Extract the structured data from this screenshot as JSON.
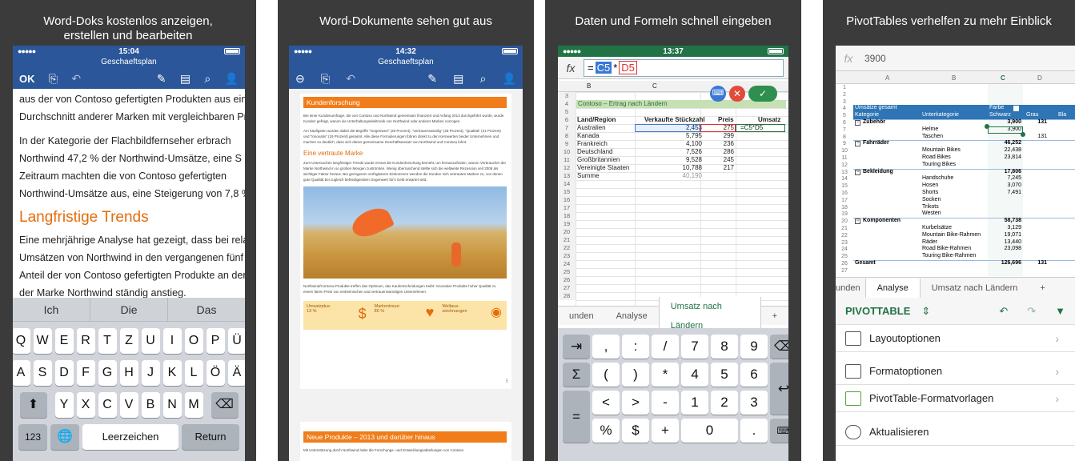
{
  "panels": [
    {
      "caption": "Word-Doks kostenlos anzeigen,\nerstellen und bearbeiten"
    },
    {
      "caption": "Word-Dokumente sehen gut aus"
    },
    {
      "caption": "Daten und Formeln schnell eingeben"
    },
    {
      "caption": "PivotTables verhelfen zu mehr Einblick"
    }
  ],
  "word1": {
    "time": "15:04",
    "title": "Geschaeftsplan",
    "ok": "OK",
    "lines_a": [
      "aus der von Contoso gefertigten Produkten aus einer Ge",
      "Durchschnitt anderer Marken mit vergleichbaren Pr"
    ],
    "lines_b": [
      "In der Kategorie der Flachbildfernseher erbrach",
      "Northwind 47,2 % der Northwind-Umsätze, eine S",
      "Zeitraum machten die von Contoso gefertigten",
      "Northwind-Umsätze aus, eine Steigerung von 7,8 %"
    ],
    "heading": "Langfristige Trends",
    "lines_c": [
      "Eine mehrjährige Analyse hat gezeigt, dass bei rela",
      "Umsätzen von Northwind in den vergangenen fünf",
      "Anteil der von Contoso gefertigten Produkte an der",
      "der Marke Northwind ständig anstieg."
    ],
    "suggestions": [
      "Ich",
      "Die",
      "Das"
    ],
    "row1": [
      "Q",
      "W",
      "E",
      "R",
      "T",
      "Z",
      "U",
      "I",
      "O",
      "P",
      "Ü"
    ],
    "row2": [
      "A",
      "S",
      "D",
      "F",
      "G",
      "H",
      "J",
      "K",
      "L",
      "Ö",
      "Ä"
    ],
    "row3": [
      "Y",
      "X",
      "C",
      "V",
      "B",
      "N",
      "M"
    ],
    "k123": "123",
    "space": "Leerzeichen",
    "ret": "Return"
  },
  "word2": {
    "time": "14:32",
    "title": "Geschaeftsplan",
    "h1": "Kundenforschung",
    "p1": "Bei einer Kundenumfrage, die von Contoso und Northwind gemeinsam finanziert und Anfang 2013 durchgeführt wurde, wurde Kunden gefragt, warum sie Unterhaltungselektronik von Northwind oder anderer Marken vorzogen.",
    "p2": "Am häufigsten wurden dabei die Begriffe \"Gegenwert\" (26 Prozent), \"vertrauenswürdig\" (29 Prozent), \"Qualität\" (21 Prozent) und \"innovativ\" (19 Prozent) genannt. Alle diese Formulierungen führen direkt zu den Kernwerten beider Unternehmen und machen so deutlich, dass sich dieser gemeinsame Geschäftsansatz von Northwind und Contoso lohnt.",
    "h2": "Eine vertraute Marke",
    "p3": "Zum Untersuchen langfristiger Trends wurde erneut die Kundenforschung bemüht, um herauszufinden, warum Verbraucher der Marke Northwind in so großen Mengen zuströmten. Wenig überraschend stellte sich die weltweite Rezession seit 2008 als wichtiger Faktor heraus. Bei geringerem verfügbarem Einkommen wenden die Kunden sich vertrauten Marken zu, von denen gute Qualität bei zugleich befriedigendem Gegenwert für's Geld erwartet wird.",
    "p4": "Northwind/Contoso-Produkte treffen das Optimum, das Kaufentscheidungen treibt: innovative Produkte hoher Qualität zu einem fairen Preis von einheimischen und vertrauenswürdigen Unternehmen.",
    "info": [
      {
        "label": "Umsatzplus:",
        "value": "13 %"
      },
      {
        "label": "Markentreue:",
        "value": "80 %"
      },
      {
        "label": "Weltaus-\nzeichnungen",
        "value": ""
      }
    ],
    "page_no": "5",
    "h3": "Neue Produkte – 2013 und darüber hinaus",
    "p5": "Mit Unterstützung durch Northwind habe die Forschungs- und Entwicklungsabteilungen von Contoso"
  },
  "excel": {
    "time": "13:37",
    "fx": "fx",
    "formula_a": "C5",
    "formula_op": "*",
    "formula_b": "D5",
    "cols": [
      "B",
      "C"
    ],
    "title": "Contoso – Ertrag nach Ländern",
    "headers": [
      "Land/Region",
      "Verkaufte Stückzahl",
      "Preis",
      "Umsatz"
    ],
    "rows": [
      [
        "Australien",
        "2,453",
        "275",
        "=C5*D5"
      ],
      [
        "Kanada",
        "5,795",
        "299",
        ""
      ],
      [
        "Frankreich",
        "4,100",
        "236",
        ""
      ],
      [
        "Deutschland",
        "7,526",
        "286",
        ""
      ],
      [
        "Großbritannien",
        "9,528",
        "245",
        ""
      ],
      [
        "Vereinigte Staaten",
        "10,788",
        "217",
        ""
      ],
      [
        "Summe",
        "40,190",
        "",
        ""
      ]
    ],
    "tabs": [
      "unden",
      "Analyse",
      "Umsatz nach Ländern",
      "+"
    ],
    "keys": {
      "r1": [
        "⇥",
        ",",
        ":",
        "/",
        "7",
        "8",
        "9",
        "⌫"
      ],
      "r2": [
        "Σ",
        "(",
        ")",
        "*",
        "4",
        "5",
        "6"
      ],
      "r3": [
        "=",
        "<",
        ">",
        "-",
        "1",
        "2",
        "3"
      ],
      "r4": [
        "%",
        "$",
        "+",
        "0",
        "."
      ],
      "ret": "↩",
      "kbd": "⌨"
    }
  },
  "pivot": {
    "fx": "fx",
    "value": "3900",
    "cols": [
      "A",
      "B",
      "C",
      "D"
    ],
    "rownums": [
      "1",
      "2",
      "3",
      "4",
      "5",
      "6",
      "7",
      "8",
      "9",
      "10",
      "11",
      "12",
      "13",
      "14",
      "15",
      "16",
      "17",
      "18",
      "19",
      "20",
      "21",
      "22",
      "23",
      "24",
      "25",
      "26",
      "27"
    ],
    "hdr": {
      "a": "Umsätze gesamt",
      "b": "Farbe",
      "c": "Kategorie",
      "d": "Unterkategorie",
      "e": "Schwarz",
      "f": "Grau",
      "g": "Bla"
    },
    "rows": [
      {
        "cat": "Zubehör",
        "sub": "",
        "v": "3,900",
        "g": "131"
      },
      {
        "cat": "",
        "sub": "Helme",
        "v": "3,900",
        "g": ""
      },
      {
        "cat": "",
        "sub": "Taschen",
        "v": "",
        "g": "131"
      },
      {
        "cat": "Fahrräder",
        "sub": "",
        "v": "46,252",
        "g": ""
      },
      {
        "cat": "",
        "sub": "Mountain Bikes",
        "v": "22,438",
        "g": ""
      },
      {
        "cat": "",
        "sub": "Road Bikes",
        "v": "23,814",
        "g": ""
      },
      {
        "cat": "",
        "sub": "Touring Bikes",
        "v": "",
        "g": ""
      },
      {
        "cat": "Bekleidung",
        "sub": "",
        "v": "17,806",
        "g": ""
      },
      {
        "cat": "",
        "sub": "Handschuhe",
        "v": "7,245",
        "g": ""
      },
      {
        "cat": "",
        "sub": "Hosen",
        "v": "3,070",
        "g": ""
      },
      {
        "cat": "",
        "sub": "Shorts",
        "v": "7,491",
        "g": ""
      },
      {
        "cat": "",
        "sub": "Socken",
        "v": "",
        "g": ""
      },
      {
        "cat": "",
        "sub": "Trikots",
        "v": "",
        "g": ""
      },
      {
        "cat": "",
        "sub": "Westen",
        "v": "",
        "g": ""
      },
      {
        "cat": "Komponenten",
        "sub": "",
        "v": "58,738",
        "g": ""
      },
      {
        "cat": "",
        "sub": "Kurbelsätze",
        "v": "3,129",
        "g": ""
      },
      {
        "cat": "",
        "sub": "Mountain Bike-Rahmen",
        "v": "19,071",
        "g": ""
      },
      {
        "cat": "",
        "sub": "Räder",
        "v": "13,440",
        "g": ""
      },
      {
        "cat": "",
        "sub": "Road Bike-Rahmen",
        "v": "23,098",
        "g": ""
      },
      {
        "cat": "",
        "sub": "Touring Bike-Rahmen",
        "v": "",
        "g": ""
      },
      {
        "cat": "Gesamt",
        "sub": "",
        "v": "126,696",
        "g": "131"
      }
    ],
    "tabs": [
      "unden",
      "Analyse",
      "Umsatz nach Ländern",
      "+"
    ],
    "pivot_label": "PIVOTTABLE",
    "options": [
      "Layoutoptionen",
      "Formatoptionen",
      "PivotTable-Formatvorlagen",
      "Aktualisieren"
    ]
  }
}
